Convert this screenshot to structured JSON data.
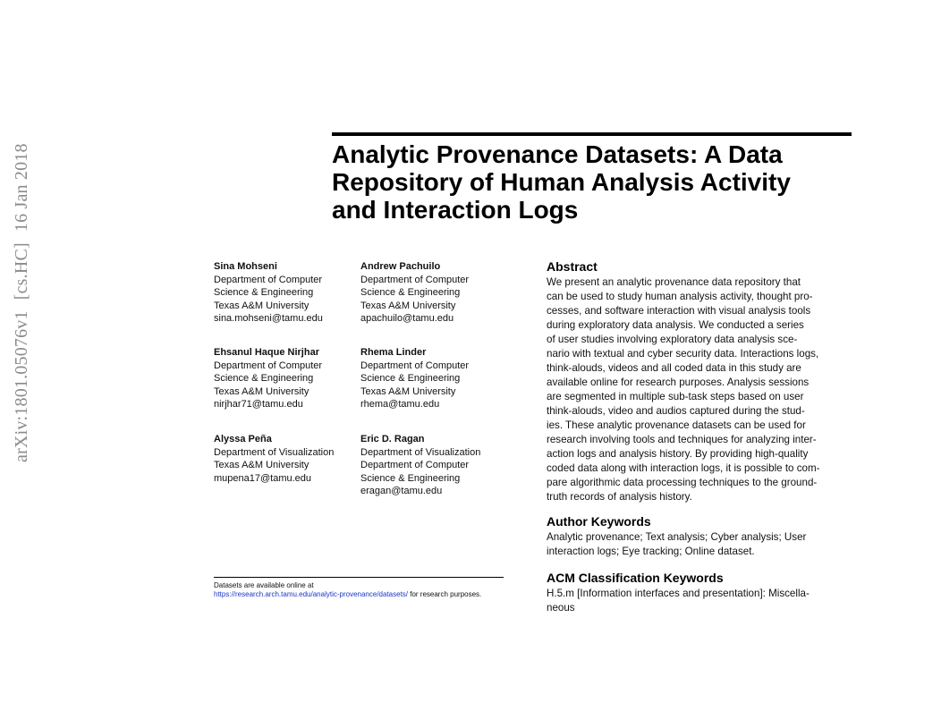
{
  "arxiv_stamp": {
    "id": "arXiv:1801.05076v1",
    "category": "[cs.HC]",
    "date": "16 Jan 2018"
  },
  "title_lines": [
    "Analytic Provenance Datasets: A Data",
    "Repository of Human Analysis Activity",
    "and Interaction Logs"
  ],
  "authors": [
    {
      "name": "Sina Mohseni",
      "lines": [
        "Department of Computer",
        "Science & Engineering",
        "Texas A&M University",
        "sina.mohseni@tamu.edu"
      ]
    },
    {
      "name": "Andrew Pachuilo",
      "lines": [
        "Department of Computer",
        "Science & Engineering",
        "Texas A&M University",
        "apachuilo@tamu.edu"
      ]
    },
    {
      "name": "Ehsanul Haque Nirjhar",
      "lines": [
        "Department of Computer",
        "Science & Engineering",
        "Texas A&M University",
        "nirjhar71@tamu.edu"
      ]
    },
    {
      "name": "Rhema Linder",
      "lines": [
        "Department of Computer",
        "Science & Engineering",
        "Texas A&M University",
        "rhema@tamu.edu"
      ]
    },
    {
      "name": "Alyssa Peña",
      "lines": [
        "Department of Visualization",
        "Texas A&M University",
        "mupena17@tamu.edu"
      ]
    },
    {
      "name": "Eric D. Ragan",
      "lines": [
        "Department of Visualization",
        "Department of Computer",
        "Science & Engineering",
        "eragan@tamu.edu"
      ]
    }
  ],
  "footnote": {
    "line1": "Datasets are available online at",
    "link": "https://research.arch.tamu.edu/analytic-provenance/datasets/",
    "suffix": " for research purposes."
  },
  "abstract": {
    "heading": "Abstract",
    "lines": [
      "We present an analytic provenance data repository that",
      "can be used to study human analysis activity, thought pro-",
      "cesses, and software interaction with visual analysis tools",
      "during exploratory data analysis. We conducted a series",
      "of user studies involving exploratory data analysis sce-",
      "nario with textual and cyber security data. Interactions logs,",
      "think-alouds, videos and all coded data in this study are",
      "available online for research purposes. Analysis sessions",
      "are segmented in multiple sub-task steps based on user",
      "think-alouds, video and audios captured during the stud-",
      "ies. These analytic provenance datasets can be used for",
      "research involving tools and techniques for analyzing inter-",
      "action logs and analysis history. By providing high-quality",
      "coded data along with interaction logs, it is possible to com-",
      "pare algorithmic data processing techniques to the ground-",
      "truth records of analysis history."
    ]
  },
  "author_keywords": {
    "heading": "Author Keywords",
    "lines": [
      "Analytic provenance; Text analysis; Cyber analysis; User",
      "interaction logs; Eye tracking; Online dataset."
    ]
  },
  "acm_keywords": {
    "heading": "ACM Classification Keywords",
    "lines": [
      "H.5.m [Information interfaces and presentation]: Miscella-",
      "neous"
    ]
  }
}
